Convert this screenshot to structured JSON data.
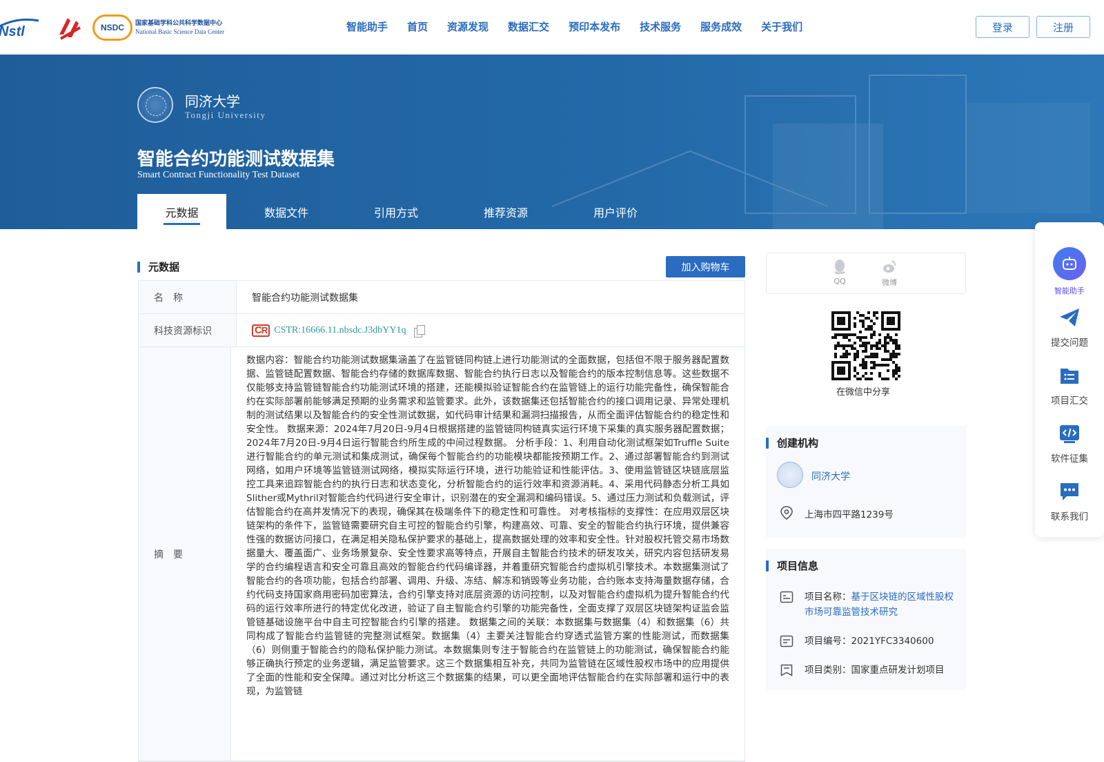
{
  "header": {
    "nav": [
      "智能助手",
      "首页",
      "资源发现",
      "数据汇交",
      "预印本发布",
      "技术服务",
      "服务成效",
      "关于我们"
    ],
    "login_label": "登录",
    "register_label": "注册",
    "logo_nsdc_badge": "NSDC",
    "logo_nsdc_zh": "国家基础学科公共科学数据中心",
    "logo_nsdc_en": "National Basic Science Data Center",
    "logo_nstl": "Nstl"
  },
  "banner": {
    "university_name": "同济大学",
    "university_name_en": "Tongji University",
    "dataset_title": "智能合约功能测试数据集",
    "dataset_title_en": "Smart Contract Functionality Test Dataset",
    "tabs": [
      "元数据",
      "数据文件",
      "引用方式",
      "推荐资源",
      "用户评价"
    ]
  },
  "metadata_section": {
    "title": "元数据",
    "cart_button": "加入购物车",
    "rows": [
      {
        "key": "名　称",
        "value": "智能合约功能测试数据集"
      },
      {
        "key": "科技资源标识",
        "value": "CSTR:16666.11.nbsdc.J3dbYY1q",
        "badge": "CSTR"
      },
      {
        "key": "摘　要",
        "value": "数据内容：智能合约功能测试数据集涵盖了在监管链同构链上进行功能测试的全面数据，包括但不限于服务器配置数据、监管链配置数据、智能合约存储的数据库数据、智能合约执行日志以及智能合约的版本控制信息等。这些数据不仅能够支持监管链智能合约功能测试环境的搭建，还能模拟验证智能合约在监管链上的运行功能完备性，确保智能合约在实际部署前能够满足预期的业务需求和监管要求。此外，该数据集还包括智能合约的接口调用记录、异常处理机制的测试结果以及智能合约的安全性测试数据，如代码审计结果和漏洞扫描报告，从而全面评估智能合约的稳定性和安全性。 数据来源：2024年7月20日-9月4日根据搭建的监管链同构链真实运行环境下采集的真实服务器配置数据；2024年7月20日-9月4日运行智能合约所生成的中间过程数据。 分析手段：1、利用自动化测试框架如Truffle Suite进行智能合约的单元测试和集成测试，确保每个智能合约的功能模块都能按预期工作。2、通过部署智能合约到测试网络，如用户环境等监管链测试网络，模拟实际运行环境，进行功能验证和性能评估。3、使用监管链区块链底层监控工具来追踪智能合约的执行日志和状态变化，分析智能合约的运行效率和资源消耗。4、采用代码静态分析工具如Slither或Mythril对智能合约代码进行安全审计，识别潜在的安全漏洞和编码错误。5、通过压力测试和负载测试，评估智能合约在高并发情况下的表现，确保其在极端条件下的稳定性和可靠性。 对考核指标的支撑性：在应用双层区块链架构的条件下，监管链需要研究自主可控的智能合约引擎，构建高效、可靠、安全的智能合约执行环境，提供兼容性强的数据访问接口，在满足相关隐私保护要求的基础上，提高数据处理的效率和安全性。针对股权托管交易市场数据量大、覆盖面广、业务场景复杂、安全性要求高等特点，开展自主智能合约技术的研发攻关，研究内容包括研发易学的合约编程语言和安全可靠且高效的智能合约代码编译器，并着重研究智能合约虚拟机引擎技术。本数据集测试了智能合约的各项功能，包括合约部署、调用、升级、冻结、解冻和销毁等业务功能，合约账本支持海量数据存储，合约代码支持国家商用密码加密算法，合约引擎支持对底层资源的访问控制，以及对智能合约虚拟机为提升智能合约代码的运行效率所进行的特定优化改进，验证了自主智能合约引擎的功能完备性，全面支撑了双层区块链架构证监会监管链基础设施平台中自主可控智能合约引擎的搭建。 数据集之间的关联：本数据集与数据集（4）和数据集（6）共同构成了智能合约监管链的完整测试框架。数据集（4）主要关注智能合约穿透式监管方案的性能测试，而数据集（6）则侧重于智能合约的隐私保护能力测试。本数据集则专注于智能合约在监管链上的功能测试，确保智能合约能够正确执行预定的业务逻辑，满足监管要求。这三个数据集相互补充，共同为监管链在区域性股权市场中的应用提供了全面的性能和安全保障。通过对比分析这三个数据集的结果，可以更全面地评估智能合约在实际部署和运行中的表现，为监管链"
      }
    ]
  },
  "share": {
    "qq_label": "QQ",
    "weibo_label": "微博",
    "qr_caption": "在微信中分享"
  },
  "creator": {
    "title": "创建机构",
    "org_name": "同济大学",
    "address": "上海市四平路1239号"
  },
  "project": {
    "title": "项目信息",
    "name_key": "项目名称：",
    "name_value": "基于区块链的区域性股权市场可靠监管技术研究",
    "number": "项目编号：2021YFC3340600",
    "category": "项目类别：国家重点研发计划项目"
  },
  "side_toolbar": {
    "items": [
      "智能助手",
      "提交问题",
      "项目汇交",
      "软件征集",
      "联系我们"
    ]
  },
  "colors": {
    "primary": "#2a6cbf",
    "banner": "#2369a8",
    "cstr_teal": "#2b9a96",
    "ai_purple": "#5a4ee8"
  }
}
